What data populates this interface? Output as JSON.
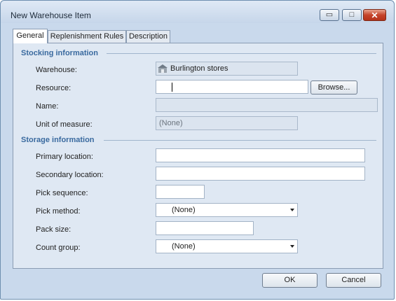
{
  "window": {
    "title": "New Warehouse Item"
  },
  "title_buttons": {
    "minimize": "▭",
    "maximize": "□",
    "close": "✕"
  },
  "tabs": [
    {
      "label": "General",
      "active": true
    },
    {
      "label": "Replenishment Rules",
      "active": false
    },
    {
      "label": "Description",
      "active": false
    }
  ],
  "stocking": {
    "header": "Stocking information",
    "warehouse_label": "Warehouse:",
    "warehouse_value": "Burlington stores",
    "resource_label": "Resource:",
    "resource_value": "",
    "browse_label": "Browse...",
    "name_label": "Name:",
    "name_value": "",
    "uom_label": "Unit of measure:",
    "uom_value": "(None)"
  },
  "storage": {
    "header": "Storage information",
    "primary_label": "Primary location:",
    "primary_value": "",
    "secondary_label": "Secondary location:",
    "secondary_value": "",
    "pick_sequence_label": "Pick sequence:",
    "pick_sequence_value": "",
    "pick_method_label": "Pick method:",
    "pick_method_value": "(None)",
    "pack_size_label": "Pack size:",
    "pack_size_value": "",
    "count_group_label": "Count group:",
    "count_group_value": "(None)"
  },
  "footer": {
    "ok_label": "OK",
    "cancel_label": "Cancel"
  }
}
